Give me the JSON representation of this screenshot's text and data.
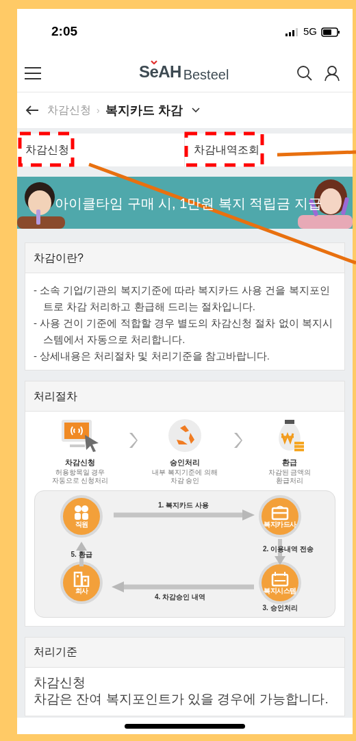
{
  "status_bar": {
    "time": "2:05",
    "network": "5G"
  },
  "header": {
    "logo_brand": "SeAH",
    "logo_name": "Besteel"
  },
  "breadcrumb": {
    "parent": "차감신청",
    "separator": "›",
    "current": "복지카드 차감"
  },
  "tabs": [
    {
      "label": "차감신청",
      "highlighted": true
    },
    {
      "label": "차감내역조회",
      "highlighted": true
    }
  ],
  "banner": {
    "kind": "picture",
    "text": "아이클타임 구매 시, 1만원 복지 적립금 지급"
  },
  "sections": [
    {
      "kind": "bullets",
      "title": "차감이란?",
      "items": [
        "- 소속 기업/기관의 복지기준에 따라 복지카드 사용 건을 복지포인트로 차감 처리하고 환급해 드리는 절차입니다.",
        "- 사용 건이 기준에 적합할 경우 별도의 차감신청 절차 없이 복지시스템에서 자동으로 처리합니다.",
        "- 상세내용은 처리절차 및 처리기준을 참고바랍니다."
      ]
    },
    {
      "kind": "process",
      "title": "처리절차",
      "steps": [
        {
          "kind": "monitor",
          "title": "차감신청",
          "lines": [
            "허용항목일 경우",
            "자동으로 신청처리"
          ]
        },
        {
          "kind": "recycle",
          "title": "승인처리",
          "lines": [
            "내부 복지기준에 의해",
            "차감 승인"
          ]
        },
        {
          "kind": "moneybag",
          "title": "환급",
          "lines": [
            "차감된 금액의",
            "환급처리"
          ]
        }
      ],
      "nodes": [
        {
          "kind": "people",
          "label": "직원"
        },
        {
          "kind": "card",
          "label": "복지카드사"
        },
        {
          "kind": "building",
          "label": "회사"
        },
        {
          "kind": "calendar",
          "label": "복지시스템"
        }
      ],
      "edges": [
        "1. 복지카드 사용",
        "2. 이용내역 전송",
        "3. 승인처리",
        "4. 차감승인 내역",
        "5. 환급"
      ]
    },
    {
      "kind": "text",
      "title": "처리기준",
      "lines": [
        "차감신청",
        "차감은 잔여 복지포인트가 있을 경우에 가능합니다."
      ]
    }
  ],
  "annotations": [
    {
      "kind": "line"
    },
    {
      "kind": "line"
    }
  ]
}
